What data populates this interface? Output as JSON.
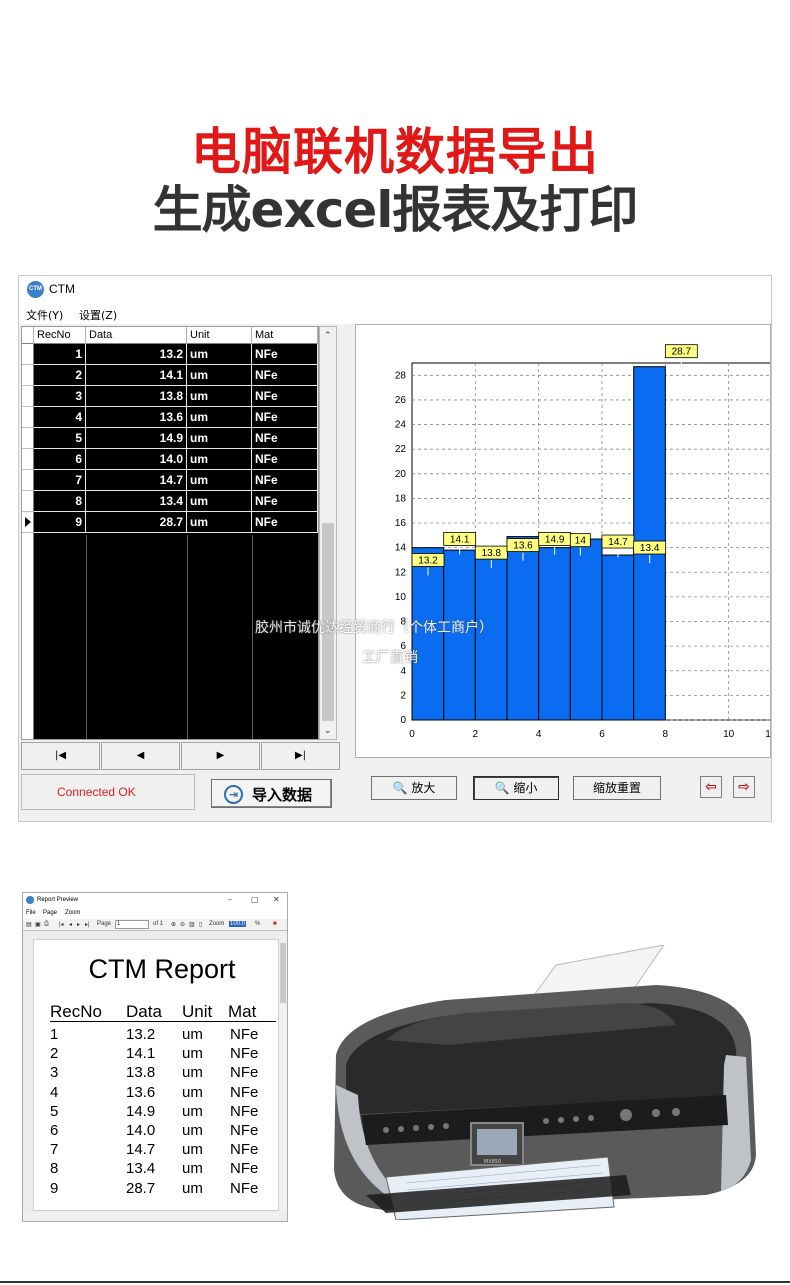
{
  "headline": {
    "line1": "电脑联机数据导出",
    "line2": "生成excel报表及打印"
  },
  "app": {
    "icon_label": "CTM",
    "title": "CTM",
    "menu": [
      "文件(Y)",
      "设置(Z)"
    ]
  },
  "grid": {
    "columns": [
      "RecNo",
      "Data",
      "Unit",
      "Mat"
    ],
    "rows": [
      {
        "recno": "1",
        "data": "13.2",
        "unit": "um",
        "mat": "NFe"
      },
      {
        "recno": "2",
        "data": "14.1",
        "unit": "um",
        "mat": "NFe"
      },
      {
        "recno": "3",
        "data": "13.8",
        "unit": "um",
        "mat": "NFe"
      },
      {
        "recno": "4",
        "data": "13.6",
        "unit": "um",
        "mat": "NFe"
      },
      {
        "recno": "5",
        "data": "14.9",
        "unit": "um",
        "mat": "NFe"
      },
      {
        "recno": "6",
        "data": "14.0",
        "unit": "um",
        "mat": "NFe"
      },
      {
        "recno": "7",
        "data": "14.7",
        "unit": "um",
        "mat": "NFe"
      },
      {
        "recno": "8",
        "data": "13.4",
        "unit": "um",
        "mat": "NFe"
      },
      {
        "recno": "9",
        "data": "28.7",
        "unit": "um",
        "mat": "NFe"
      }
    ],
    "current_row": 9
  },
  "nav": {
    "first": "|◀",
    "prev": "◀",
    "next": "▶",
    "last": "▶|"
  },
  "status": {
    "text": "Connected OK"
  },
  "import_button": {
    "label": "导入数据"
  },
  "toolbar": {
    "zoom_in": "放大",
    "zoom_out": "缩小",
    "zoom_reset": "缩放重置",
    "left_arrow": "⇦",
    "right_arrow": "⇨"
  },
  "chart_data": {
    "type": "bar",
    "x": [
      0,
      1,
      2,
      3,
      4,
      5,
      6,
      7,
      8
    ],
    "values": [
      14.0,
      13.8,
      13.6,
      14.9,
      14.0,
      14.7,
      13.4,
      28.7,
      null
    ],
    "labels": [
      "13.2",
      "14.1",
      "13.8",
      "13.6",
      "14.9",
      "14",
      "14.7",
      "13.4",
      "28.7"
    ],
    "label_values": [
      13.2,
      14.1,
      13.8,
      13.6,
      14.9,
      14.0,
      14.7,
      13.4,
      28.7
    ],
    "xlim": [
      0,
      12
    ],
    "ylim": [
      0,
      29
    ],
    "x_ticks": [
      "0",
      "2",
      "4",
      "6",
      "8",
      "10",
      "1"
    ],
    "y_ticks": [
      "0",
      "2",
      "4",
      "6",
      "8",
      "10",
      "12",
      "14",
      "16",
      "18",
      "20",
      "22",
      "24",
      "26",
      "28"
    ],
    "bar_color": "#0a6cf0",
    "label_bg": "#ffff80",
    "grid": true
  },
  "watermark": {
    "line1": "胶州市诚优达经贸商行（个体工商户）",
    "line2": "工厂直销"
  },
  "report_preview": {
    "window_title": "Report Preview",
    "menu": [
      "File",
      "Page",
      "Zoom"
    ],
    "toolbar_page_label": "Page",
    "toolbar_page_value": "1",
    "toolbar_of": "of 1",
    "toolbar_zoom_label": "Zoom",
    "toolbar_zoom_value": "100.0",
    "toolbar_percent": "%",
    "report_title": "CTM Report",
    "columns": [
      "RecNo",
      "Data",
      "Unit",
      "Mat"
    ],
    "rows": [
      [
        "1",
        "13.2",
        "um",
        "NFe"
      ],
      [
        "2",
        "14.1",
        "um",
        "NFe"
      ],
      [
        "3",
        "13.8",
        "um",
        "NFe"
      ],
      [
        "4",
        "13.6",
        "um",
        "NFe"
      ],
      [
        "5",
        "14.9",
        "um",
        "NFe"
      ],
      [
        "6",
        "14.0",
        "um",
        "NFe"
      ],
      [
        "7",
        "14.7",
        "um",
        "NFe"
      ],
      [
        "8",
        "13.4",
        "um",
        "NFe"
      ],
      [
        "9",
        "28.7",
        "um",
        "NFe"
      ]
    ]
  },
  "printer": {
    "model_text": "MX850"
  }
}
